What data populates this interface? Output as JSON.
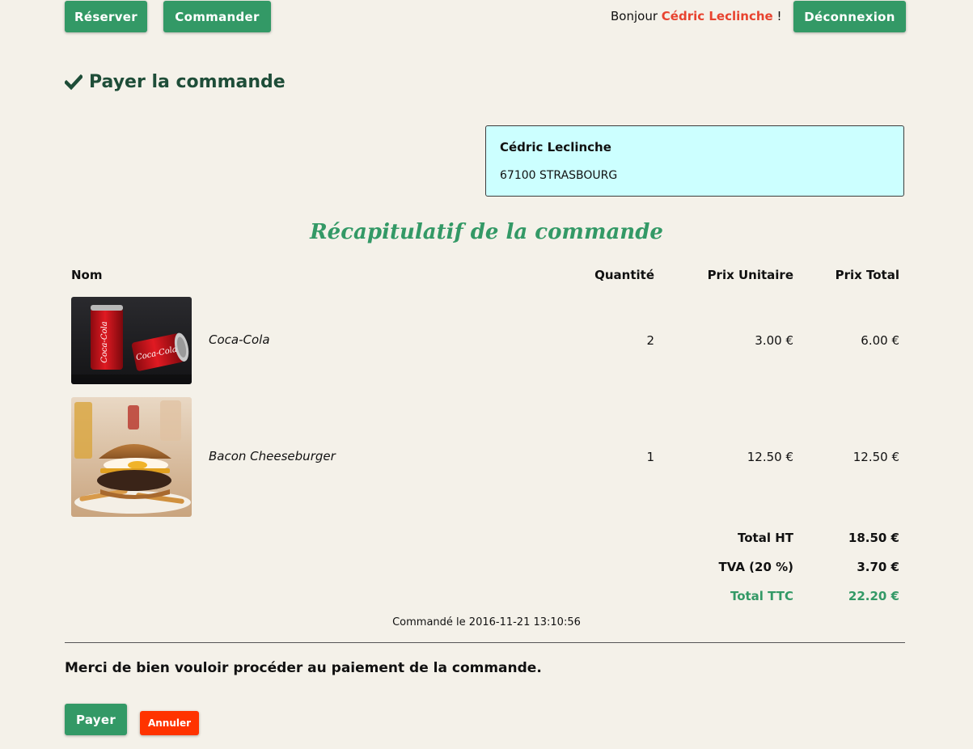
{
  "nav": {
    "reserve_label": "Réserver",
    "order_label": "Commander",
    "greeting_prefix": "Bonjour",
    "user_name": "Cédric Leclinche",
    "greeting_suffix": "!",
    "logout_label": "Déconnexion"
  },
  "page": {
    "title": "Payer la commande",
    "title_icon": "check-icon"
  },
  "address": {
    "name": "Cédric Leclinche",
    "city": "67100 STRASBOURG"
  },
  "recap": {
    "title": "Récapitulatif de la commande",
    "columns": [
      "Nom",
      "Quantité",
      "Prix Unitaire",
      "Prix Total"
    ],
    "items": [
      {
        "name": "Coca-Cola",
        "quantity": "2",
        "unit_price": "3.00 €",
        "total": "6.00 €",
        "image": "coca-cola-cans-photo"
      },
      {
        "name": "Bacon Cheeseburger",
        "quantity": "1",
        "unit_price": "12.50 €",
        "total": "12.50 €",
        "image": "cheeseburger-photo"
      }
    ],
    "totals": {
      "ht_label": "Total HT",
      "ht_value": "18.50 €",
      "tva_label": "TVA (20 %)",
      "tva_value": "3.70 €",
      "ttc_label": "Total TTC",
      "ttc_value": "22.20 €"
    },
    "order_date": "Commandé le 2016-11-21 13:10:56"
  },
  "payment": {
    "message": "Merci de bien vouloir procéder au paiement de la commande.",
    "pay_label": "Payer",
    "cancel_label": "Annuler"
  },
  "colors": {
    "background": "#f4f1e9",
    "primary": "#339966",
    "accent_user": "#e8432f",
    "danger": "#ff3300",
    "address_box": "#ccffff"
  }
}
